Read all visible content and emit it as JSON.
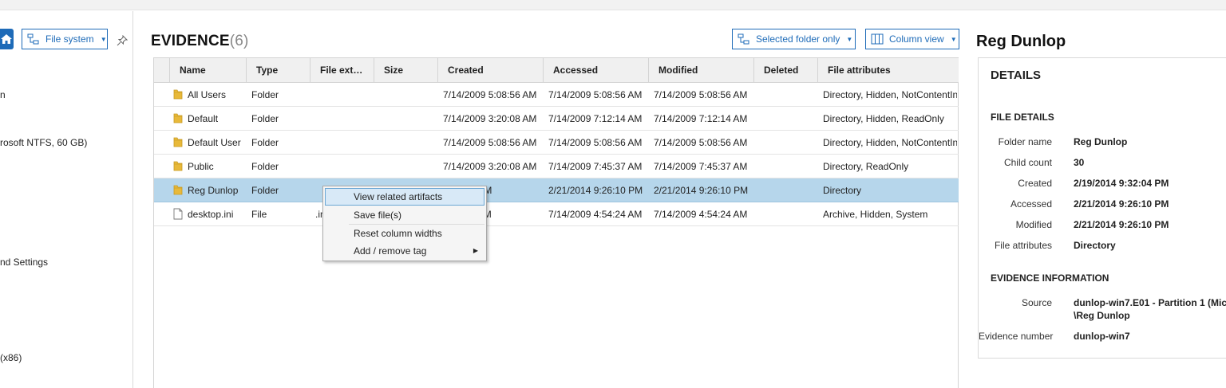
{
  "left_panel": {
    "view_select": "File system",
    "tree_items": [
      "n",
      "rosoft NTFS, 60 GB)",
      "nd Settings",
      " (x86)"
    ]
  },
  "evidence": {
    "title": "EVIDENCE",
    "count": "(6)"
  },
  "toolbar": {
    "filter_select": "Selected folder only",
    "view_select": "Column view"
  },
  "grid": {
    "columns": [
      "Name",
      "Type",
      "File ext…",
      "Size",
      "Created",
      "Accessed",
      "Modified",
      "Deleted",
      "File attributes"
    ],
    "rows": [
      {
        "name": "All Users",
        "type": "Folder",
        "ext": "",
        "size": "",
        "created": "7/14/2009 5:08:56 AM",
        "accessed": "7/14/2009 5:08:56 AM",
        "modified": "7/14/2009 5:08:56 AM",
        "deleted": "",
        "attributes": "Directory, Hidden, NotContentIn"
      },
      {
        "name": "Default",
        "type": "Folder",
        "ext": "",
        "size": "",
        "created": "7/14/2009 3:20:08 AM",
        "accessed": "7/14/2009 7:12:14 AM",
        "modified": "7/14/2009 7:12:14 AM",
        "deleted": "",
        "attributes": "Directory, Hidden, ReadOnly"
      },
      {
        "name": "Default User",
        "type": "Folder",
        "ext": "",
        "size": "",
        "created": "7/14/2009 5:08:56 AM",
        "accessed": "7/14/2009 5:08:56 AM",
        "modified": "7/14/2009 5:08:56 AM",
        "deleted": "",
        "attributes": "Directory, Hidden, NotContentIn"
      },
      {
        "name": "Public",
        "type": "Folder",
        "ext": "",
        "size": "",
        "created": "7/14/2009 3:20:08 AM",
        "accessed": "7/14/2009 7:45:37 AM",
        "modified": "7/14/2009 7:45:37 AM",
        "deleted": "",
        "attributes": "Directory, ReadOnly"
      },
      {
        "name": "Reg Dunlop",
        "type": "Folder",
        "ext": "",
        "size": "",
        "created": "9:32:04 PM",
        "accessed": "2/21/2014 9:26:10 PM",
        "modified": "2/21/2014 9:26:10 PM",
        "deleted": "",
        "attributes": "Directory"
      },
      {
        "name": "desktop.ini",
        "type": "File",
        "ext": ".in",
        "size": "",
        "created": "4:54:24 AM",
        "accessed": "7/14/2009 4:54:24 AM",
        "modified": "7/14/2009 4:54:24 AM",
        "deleted": "",
        "attributes": "Archive, Hidden, System"
      }
    ]
  },
  "context_menu": {
    "items": [
      "View related artifacts",
      "Save file(s)",
      "Reset column widths",
      "Add / remove tag"
    ]
  },
  "details": {
    "title": "Reg Dunlop",
    "section_title": "DETAILS",
    "file_details": {
      "heading": "FILE DETAILS",
      "labels": [
        "Folder name",
        "Child count",
        "Created",
        "Accessed",
        "Modified",
        "File attributes"
      ],
      "values": [
        "Reg Dunlop",
        "30",
        "2/19/2014 9:32:04 PM",
        "2/21/2014 9:26:10 PM",
        "2/21/2014 9:26:10 PM",
        "Directory"
      ]
    },
    "evidence_info": {
      "heading": "EVIDENCE INFORMATION",
      "source_label": "Source",
      "source_line1": "dunlop-win7.E01 - Partition 1 (Mic",
      "source_line2": "\\Reg Dunlop",
      "number_label": "Evidence number",
      "number_value": "dunlop-win7"
    }
  },
  "colors": {
    "accent": "#1e6bb8",
    "selection": "#b6d6eb",
    "folder": "#e8b93a"
  }
}
